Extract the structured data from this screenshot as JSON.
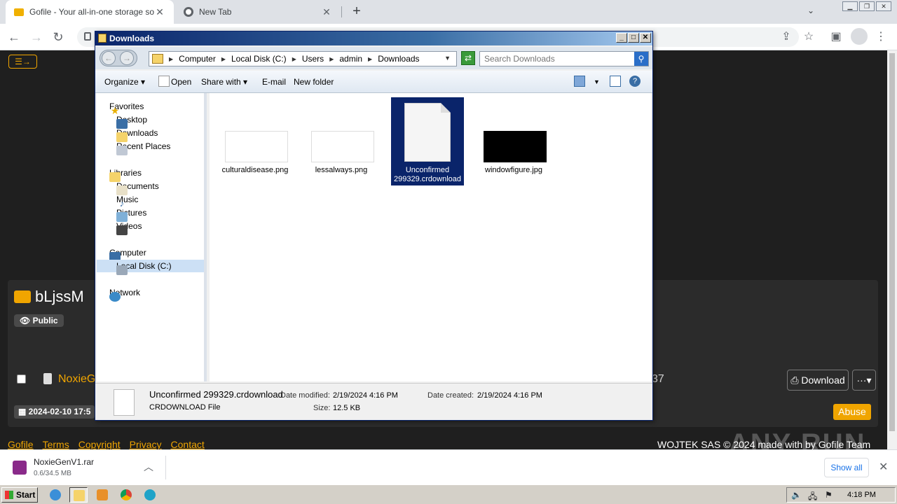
{
  "browser": {
    "tabs": [
      {
        "title": "Gofile - Your all-in-one storage soluti",
        "close": "✕"
      },
      {
        "title": "New Tab",
        "close": "✕"
      }
    ],
    "new_tab": "+",
    "tab_search": "⌄"
  },
  "page": {
    "folder_name": "bLjssM",
    "visibility_badge": "Public",
    "file_name_partial": "NoxieG",
    "stray_text": "37",
    "download_label": "Download",
    "more_label": "···▾",
    "date_text": "2024-02-10 17:5",
    "abuse_label": "Abuse",
    "footer_links": [
      "Gofile",
      "Terms",
      "Copyright",
      "Privacy",
      "Contact"
    ],
    "footer_right": "WOJTEK SAS © 2024 made with   by Gofile Team",
    "watermark": "ANY RUN"
  },
  "download_shelf": {
    "file_name": "NoxieGenV1.rar",
    "progress_text": "0.6/34.5 MB",
    "progress": 0.017,
    "show_all": "Show all"
  },
  "taskbar": {
    "start": "Start",
    "clock": "4:18 PM"
  },
  "explorer": {
    "title": "Downloads",
    "breadcrumbs": [
      "Computer",
      "Local Disk (C:)",
      "Users",
      "admin",
      "Downloads"
    ],
    "search_placeholder": "Search Downloads",
    "toolbar": {
      "organize": "Organize",
      "open": "Open",
      "share_with": "Share with",
      "email": "E-mail",
      "new_folder": "New folder"
    },
    "nav": {
      "favorites": "Favorites",
      "desktop": "Desktop",
      "downloads": "Downloads",
      "recent": "Recent Places",
      "libraries": "Libraries",
      "documents": "Documents",
      "music": "Music",
      "pictures": "Pictures",
      "videos": "Videos",
      "computer": "Computer",
      "local_disk": "Local Disk (C:)",
      "network": "Network"
    },
    "files": [
      {
        "name": "culturaldisease.png"
      },
      {
        "name": "lessalways.png"
      },
      {
        "name": "Unconfirmed 299329.crdownload"
      },
      {
        "name": "windowfigure.jpg"
      }
    ],
    "details": {
      "file_name": "Unconfirmed 299329.crdownload",
      "file_type": "CRDOWNLOAD File",
      "modified_label": "Date modified:",
      "modified_value": "2/19/2024 4:16 PM",
      "created_label": "Date created:",
      "created_value": "2/19/2024 4:16 PM",
      "size_label": "Size:",
      "size_value": "12.5 KB"
    }
  }
}
